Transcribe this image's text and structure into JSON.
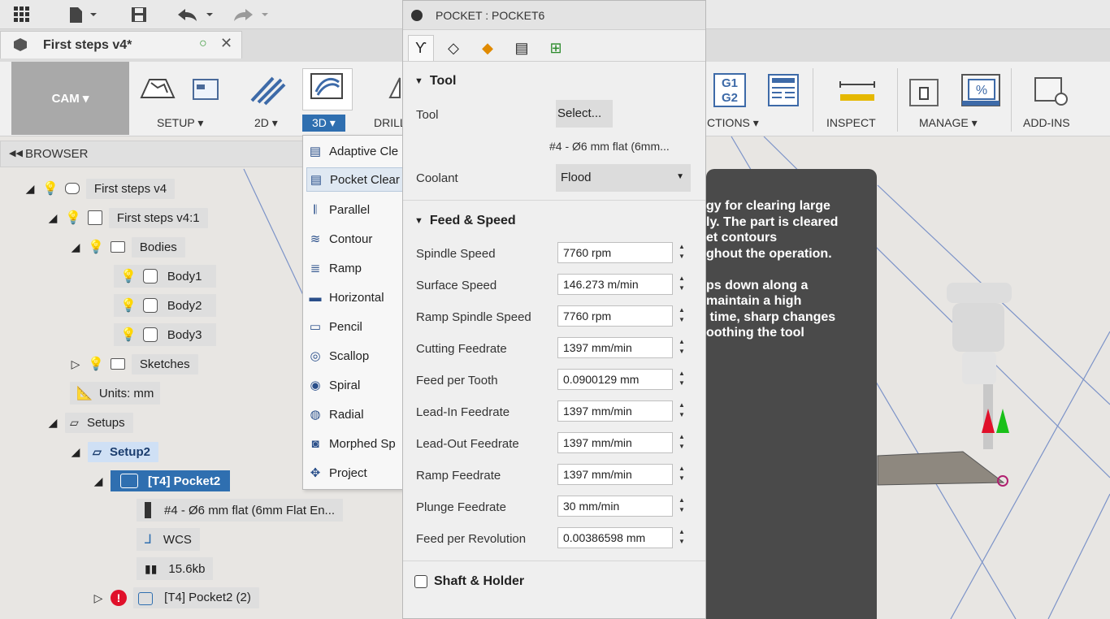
{
  "document_tab": {
    "title": "First steps v4*"
  },
  "ribbon": {
    "workspace": "CAM ▾",
    "groups": {
      "setup": "SETUP ▾",
      "two_d": "2D ▾",
      "three_d": "3D ▾",
      "drilling": "DRILL",
      "actions": "CTIONS ▾",
      "inspect": "INSPECT",
      "manage": "MANAGE ▾",
      "add_ins": "ADD-INS"
    },
    "actions_icon_text": [
      "G1",
      "G2"
    ]
  },
  "browser": {
    "header": "BROWSER",
    "nodes": {
      "root": "First steps v4",
      "component": "First steps v4:1",
      "bodies": "Bodies",
      "body1": "Body1",
      "body2": "Body2",
      "body3": "Body3",
      "sketches": "Sketches",
      "units": "Units: mm",
      "setups": "Setups",
      "setup2": "Setup2",
      "pocket2": "[T4] Pocket2",
      "tool": "#4 - Ø6 mm flat (6mm Flat En...",
      "wcs": "WCS",
      "size": "15.6kb",
      "pocket2b": "[T4] Pocket2 (2)"
    }
  },
  "menu_3d": {
    "items": [
      "Adaptive Cle",
      "Pocket Clear",
      "Parallel",
      "Contour",
      "Ramp",
      "Horizontal",
      "Pencil",
      "Scallop",
      "Spiral",
      "Radial",
      "Morphed Sp",
      "Project"
    ],
    "selected": "Pocket Clear"
  },
  "pocket_dialog": {
    "title": "POCKET : POCKET6",
    "tool_section": {
      "heading": "Tool",
      "tool_label": "Tool",
      "select_button": "Select...",
      "tool_name": "#4 - Ø6 mm flat (6mm...",
      "coolant_label": "Coolant",
      "coolant_value": "Flood"
    },
    "feed_section": {
      "heading": "Feed & Speed",
      "fields": [
        {
          "label": "Spindle Speed",
          "value": "7760 rpm"
        },
        {
          "label": "Surface Speed",
          "value": "146.273 m/min"
        },
        {
          "label": "Ramp Spindle Speed",
          "value": "7760 rpm"
        },
        {
          "label": "Cutting Feedrate",
          "value": "1397 mm/min"
        },
        {
          "label": "Feed per Tooth",
          "value": "0.0900129 mm"
        },
        {
          "label": "Lead-In Feedrate",
          "value": "1397 mm/min"
        },
        {
          "label": "Lead-Out Feedrate",
          "value": "1397 mm/min"
        },
        {
          "label": "Ramp Feedrate",
          "value": "1397 mm/min"
        },
        {
          "label": "Plunge Feedrate",
          "value": "30 mm/min"
        },
        {
          "label": "Feed per Revolution",
          "value": "0.00386598 mm"
        }
      ]
    },
    "shaft_section": {
      "heading": "Shaft & Holder"
    }
  },
  "tooltip": {
    "text": "gy for clearing large\nly. The part is cleared\net contours\nghout the operation.\n\nps down along a\nmaintain a high\n time, sharp changes\noothing the tool"
  },
  "colors": {
    "accent_blue": "#2f6fb0",
    "selection_blue": "#cfe0f5",
    "toolpath_blue": "#1010e0",
    "tooltip_bg": "#4a4a4a",
    "error_red": "#e0102a"
  }
}
